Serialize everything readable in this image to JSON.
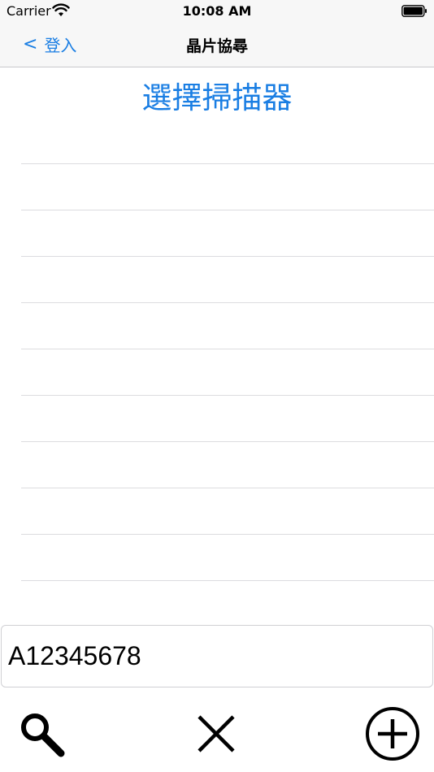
{
  "status_bar": {
    "carrier": "Carrier",
    "time": "10:08 AM"
  },
  "nav": {
    "back_label": "登入",
    "back_chevron": "<",
    "title": "晶片協尋"
  },
  "main": {
    "select_scanner_title": "選擇掃描器",
    "list_rows": [
      "",
      "",
      "",
      "",
      "",
      "",
      "",
      "",
      "",
      "",
      ""
    ]
  },
  "input": {
    "value": "A12345678"
  },
  "toolbar": {
    "icons": [
      "search-icon",
      "close-icon",
      "plus-circle-icon"
    ]
  },
  "colors": {
    "accent": "#1a7ee3",
    "bar_background": "#f7f7f7",
    "separator": "#dcdcdf"
  }
}
